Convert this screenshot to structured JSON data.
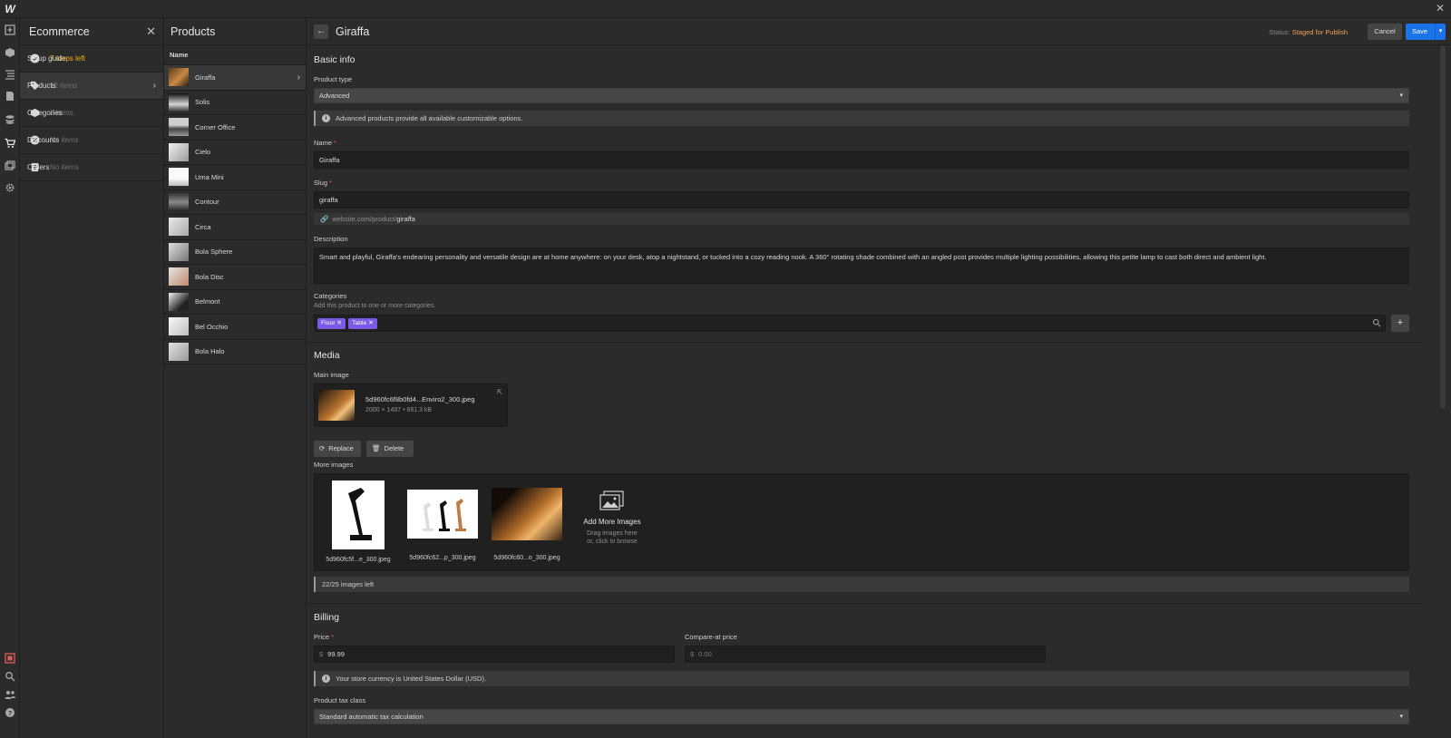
{
  "app": {
    "logo": "W",
    "close_glyph": "✕"
  },
  "rail": {
    "icons": [
      "add-panel-icon",
      "cube-icon",
      "navigator-icon",
      "pages-icon",
      "cms-icon",
      "ecommerce-icon",
      "assets-icon",
      "settings-icon"
    ],
    "bottom_icons": [
      "record-icon",
      "search-icon",
      "users-icon",
      "help-icon"
    ]
  },
  "ecommerce": {
    "title": "Ecommerce",
    "close_glyph": "✕",
    "items": [
      {
        "label": "Setup guide",
        "sub": "7 steps left"
      },
      {
        "label": "Products",
        "sub": "12 items"
      },
      {
        "label": "Categories",
        "sub": "3 items"
      },
      {
        "label": "Discounts",
        "sub": "No items"
      },
      {
        "label": "Orders",
        "sub": "No items"
      }
    ]
  },
  "products": {
    "title": "Products",
    "column": "Name",
    "items": [
      "Giraffa",
      "Solis",
      "Corner Office",
      "Cielo",
      "Uma Mini",
      "Contour",
      "Circa",
      "Bola Sphere",
      "Bola Disc",
      "Belmont",
      "Bel Occhio",
      "Bola Halo"
    ]
  },
  "editor": {
    "title": "Giraffa",
    "back_glyph": "←",
    "status_label": "Status:",
    "status_value": "Staged for Publish",
    "cancel": "Cancel",
    "save": "Save",
    "basic_info": {
      "heading": "Basic info",
      "product_type_label": "Product type",
      "product_type_value": "Advanced",
      "product_type_note": "Advanced products provide all available customizable options.",
      "name_label": "Name",
      "name_value": "Giraffa",
      "slug_label": "Slug",
      "slug_value": "giraffa",
      "slug_url_prefix": "website.com/product/",
      "slug_url_slug": "giraffa",
      "description_label": "Description",
      "description_value": "Smart and playful, Giraffa's endearing personality and versatile design are at home anywhere: on your desk, atop a nightstand, or tucked into a cozy reading nook. A 360° rotating shade combined with an angled post provides multiple lighting possibilities, allowing this petite lamp to cast both direct and ambient light.",
      "categories_label": "Categories",
      "categories_help": "Add this product to one or more categories.",
      "categories": [
        "Floor",
        "Table"
      ],
      "remove_glyph": "✕",
      "add_glyph": "+"
    },
    "media": {
      "heading": "Media",
      "main_image_label": "Main image",
      "main_image_name": "5d960fc6f8b0fd4...Enviro2_300.jpeg",
      "main_image_meta": "2000 × 1497 • 681.3 kB",
      "replace": "Replace",
      "delete": "Delete",
      "more_images_label": "More images",
      "more_images": [
        "5d960fc5f...e_300.jpeg",
        "5d960fc62...p_300.jpeg",
        "5d960fc60...o_300.jpeg"
      ],
      "add_more_title": "Add More Images",
      "add_more_line1": "Drag images here",
      "add_more_line2": "or, click to browse",
      "images_left": "22/25 images left"
    },
    "billing": {
      "heading": "Billing",
      "price_label": "Price",
      "currency_symbol": "$",
      "price_value": "99.99",
      "compare_label": "Compare-at price",
      "compare_placeholder": "0.00",
      "currency_note": "Your store currency is United States Dollar (USD).",
      "tax_class_label": "Product tax class",
      "tax_class_value": "Standard automatic tax calculation"
    }
  },
  "colors": {
    "accent": "#1a73e8",
    "status": "#f2a154",
    "warn": "#f5b400",
    "tag": "#7a5ae6"
  }
}
